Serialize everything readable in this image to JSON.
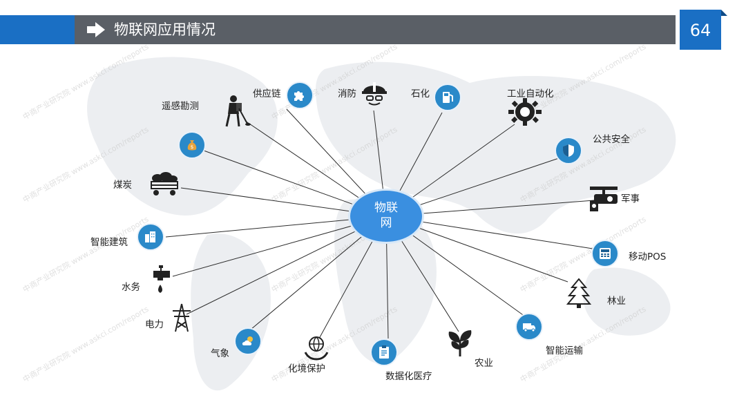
{
  "header": {
    "title": "物联网应用情况",
    "page_number": "64"
  },
  "hub": {
    "label_line1": "物联",
    "label_line2": "网"
  },
  "nodes": [
    {
      "id": "supply-chain",
      "label": "供应链"
    },
    {
      "id": "fire",
      "label": "消防"
    },
    {
      "id": "petrochem",
      "label": "石化"
    },
    {
      "id": "industrial-automation",
      "label": "工业自动化"
    },
    {
      "id": "remote-sensing",
      "label": "遥感勘测"
    },
    {
      "id": "public-safety",
      "label": "公共安全"
    },
    {
      "id": "coal",
      "label": "煤炭"
    },
    {
      "id": "military",
      "label": "军事"
    },
    {
      "id": "smart-building",
      "label": "智能建筑"
    },
    {
      "id": "mobile-pos",
      "label": "移动POS"
    },
    {
      "id": "water",
      "label": "水务"
    },
    {
      "id": "forestry",
      "label": "林业"
    },
    {
      "id": "power",
      "label": "电力"
    },
    {
      "id": "smart-transport",
      "label": "智能运输"
    },
    {
      "id": "weather",
      "label": "气象"
    },
    {
      "id": "environment",
      "label": "化境保护"
    },
    {
      "id": "digital-medical",
      "label": "数据化医疗"
    },
    {
      "id": "agriculture",
      "label": "农业"
    }
  ],
  "watermark": {
    "text_cn": "中商产业研究院",
    "text_en": "www.askci.com/reports"
  },
  "colors": {
    "accent_blue": "#1a6fc4",
    "header_gray": "#5a5f66",
    "hub_blue": "#3a8fe0",
    "icon_blue": "#2a89c9"
  }
}
